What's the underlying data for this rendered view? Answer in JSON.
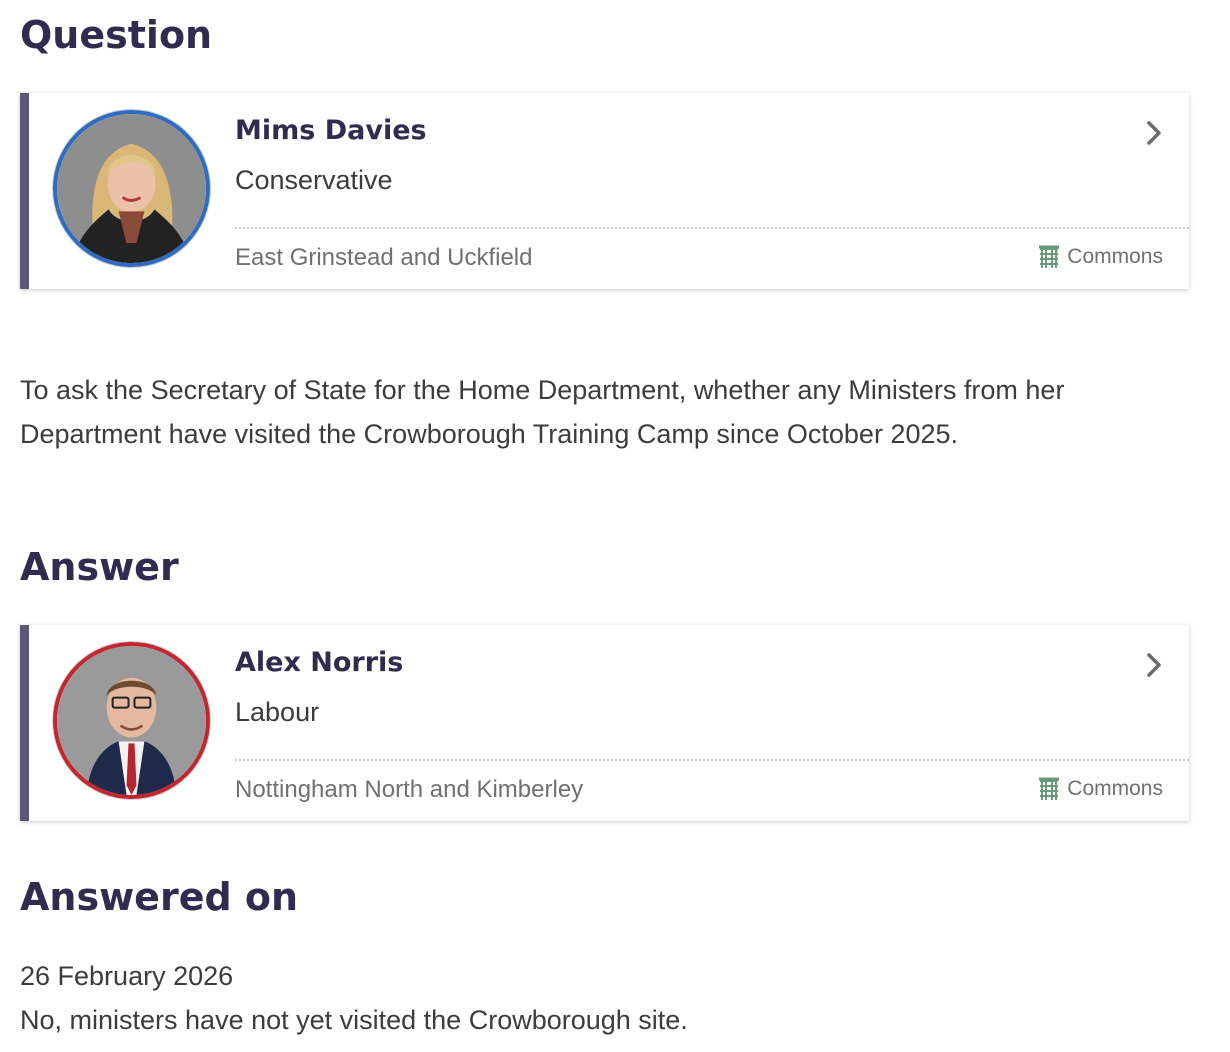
{
  "question": {
    "heading": "Question",
    "member": {
      "name": "Mims Davies",
      "party": "Conservative",
      "constituency": "East Grinstead and Uckfield",
      "house": "Commons",
      "party_color": "#2d6cc0"
    },
    "text": "To ask the Secretary of State for the Home Department, whether any Ministers from her Department have visited the Crowborough Training Camp since October 2025."
  },
  "answer": {
    "heading": "Answer",
    "member": {
      "name": "Alex Norris",
      "party": "Labour",
      "constituency": "Nottingham North and Kimberley",
      "house": "Commons",
      "party_color": "#c3262f"
    }
  },
  "answered_on": {
    "heading": "Answered on",
    "date": "26 February 2026",
    "text": "No, ministers have not yet visited the Crowborough site."
  },
  "icons": {
    "portcullis": "portcullis-icon",
    "chevron": "chevron-right-icon"
  },
  "colors": {
    "heading": "#312b4f",
    "card_accent": "#5b5778",
    "commons_green": "#6a9a7c"
  }
}
